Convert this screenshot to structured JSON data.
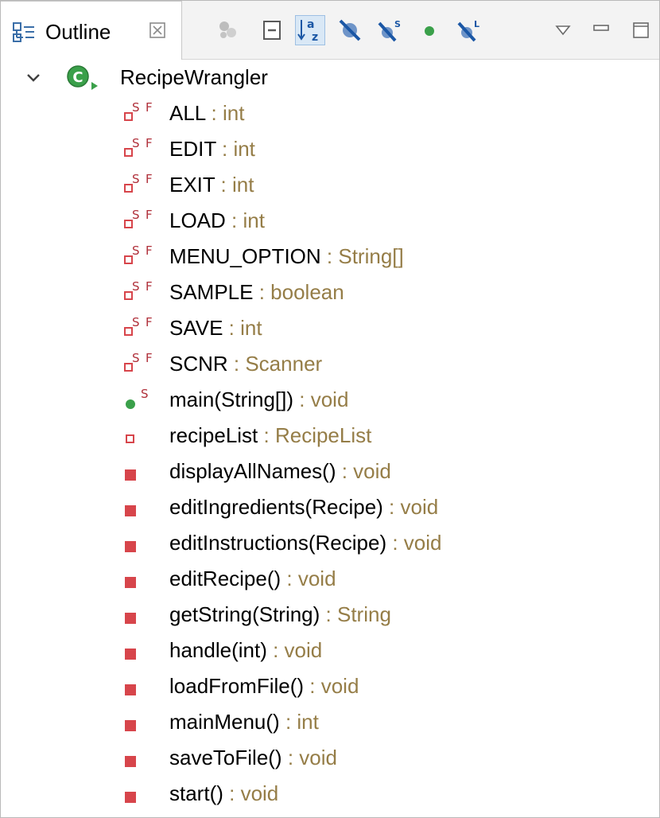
{
  "view": {
    "tab_title": "Outline",
    "tab_icon": "outline-icon",
    "tab_close_icon": "close-icon",
    "toolbar": [
      {
        "name": "focus-on-active-task-icon",
        "active": false
      },
      {
        "name": "collapse-all-icon",
        "active": false
      },
      {
        "name": "sort-icon",
        "label": "az",
        "active": true
      },
      {
        "name": "hide-fields-icon",
        "active": false
      },
      {
        "name": "hide-static-icon",
        "label": "S",
        "active": false
      },
      {
        "name": "hide-non-public-icon",
        "active": false
      },
      {
        "name": "hide-local-types-icon",
        "label": "L",
        "active": false
      },
      {
        "name": "view-menu-icon",
        "active": false
      },
      {
        "name": "minimize-icon",
        "active": false
      },
      {
        "name": "maximize-icon",
        "active": false
      }
    ]
  },
  "tree": {
    "root": {
      "label": "RecipeWrangler",
      "icon": "public-class-icon",
      "expanded": true
    },
    "members": [
      {
        "name": "ALL",
        "sep": " : ",
        "type": "int",
        "kind": "static-final-field"
      },
      {
        "name": "EDIT",
        "sep": " : ",
        "type": "int",
        "kind": "static-final-field"
      },
      {
        "name": "EXIT",
        "sep": " : ",
        "type": "int",
        "kind": "static-final-field"
      },
      {
        "name": "LOAD",
        "sep": " : ",
        "type": "int",
        "kind": "static-final-field"
      },
      {
        "name": "MENU_OPTION",
        "sep": " : ",
        "type": "String[]",
        "kind": "static-final-field"
      },
      {
        "name": "SAMPLE",
        "sep": " : ",
        "type": "boolean",
        "kind": "static-final-field"
      },
      {
        "name": "SAVE",
        "sep": " : ",
        "type": "int",
        "kind": "static-final-field"
      },
      {
        "name": "SCNR",
        "sep": " : ",
        "type": "Scanner",
        "kind": "static-final-field"
      },
      {
        "name": "main(String[])",
        "sep": " : ",
        "type": "void",
        "kind": "public-static-method"
      },
      {
        "name": "recipeList",
        "sep": " : ",
        "type": "RecipeList",
        "kind": "private-field"
      },
      {
        "name": "displayAllNames()",
        "sep": " : ",
        "type": "void",
        "kind": "private-method"
      },
      {
        "name": "editIngredients(Recipe)",
        "sep": " : ",
        "type": "void",
        "kind": "private-method"
      },
      {
        "name": "editInstructions(Recipe)",
        "sep": " : ",
        "type": "void",
        "kind": "private-method"
      },
      {
        "name": "editRecipe()",
        "sep": " : ",
        "type": "void",
        "kind": "private-method"
      },
      {
        "name": "getString(String)",
        "sep": " : ",
        "type": "String",
        "kind": "private-method"
      },
      {
        "name": "handle(int)",
        "sep": " : ",
        "type": "void",
        "kind": "private-method"
      },
      {
        "name": "loadFromFile()",
        "sep": " : ",
        "type": "void",
        "kind": "private-method"
      },
      {
        "name": "mainMenu()",
        "sep": " : ",
        "type": "int",
        "kind": "private-method"
      },
      {
        "name": "saveToFile()",
        "sep": " : ",
        "type": "void",
        "kind": "private-method"
      },
      {
        "name": "start()",
        "sep": " : ",
        "type": "void",
        "kind": "private-method"
      }
    ]
  },
  "colors": {
    "type_text": "#957d47",
    "private_red": "#d7454b",
    "public_green": "#3aa04a",
    "class_green": "#3aa04a"
  }
}
